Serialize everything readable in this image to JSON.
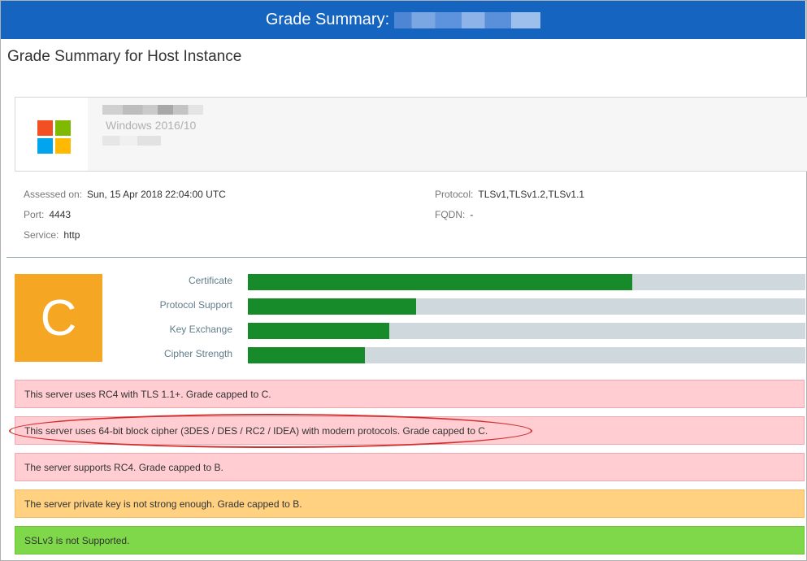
{
  "window": {
    "title": "Grade Summary:"
  },
  "page": {
    "title": "Grade Summary for Host Instance"
  },
  "host": {
    "os": "Windows 2016/10"
  },
  "details": {
    "assessed_on": {
      "label": "Assessed on:",
      "value": "Sun, 15 Apr 2018 22:04:00 UTC"
    },
    "port": {
      "label": "Port:",
      "value": "4443"
    },
    "service": {
      "label": "Service:",
      "value": "http"
    },
    "protocol": {
      "label": "Protocol:",
      "value": "TLSv1,TLSv1.2,TLSv1.1"
    },
    "fqdn": {
      "label": "FQDN:",
      "value": "-"
    }
  },
  "grade": {
    "letter": "C",
    "color": "#f5a623"
  },
  "scores": [
    {
      "label": "Certificate",
      "fraction": 0.69
    },
    {
      "label": "Protocol Support",
      "fraction": 0.302
    },
    {
      "label": "Key Exchange",
      "fraction": 0.254
    },
    {
      "label": "Cipher Strength",
      "fraction": 0.21
    }
  ],
  "alerts": [
    {
      "text": "This server uses RC4 with TLS 1.1+. Grade capped to C.",
      "level": "red"
    },
    {
      "text": "This server uses 64-bit block cipher (3DES / DES / RC2 / IDEA) with modern protocols. Grade capped to C.",
      "level": "red",
      "highlighted": true
    },
    {
      "text": "The server supports RC4. Grade capped to B.",
      "level": "red"
    },
    {
      "text": "The server private key is not strong enough. Grade capped to B.",
      "level": "orange"
    },
    {
      "text": "SSLv3 is not Supported.",
      "level": "green"
    }
  ],
  "colors": {
    "titlebar": "#1565c0",
    "bar_fill": "#178a2a",
    "bar_track": "#cfd8dc",
    "alert_red": "#ffcdd2",
    "alert_orange": "#ffd180",
    "alert_green": "#7ed84a",
    "highlight_ring": "#d32f2f"
  },
  "icons": {
    "os_logo": "windows-logo-icon"
  }
}
